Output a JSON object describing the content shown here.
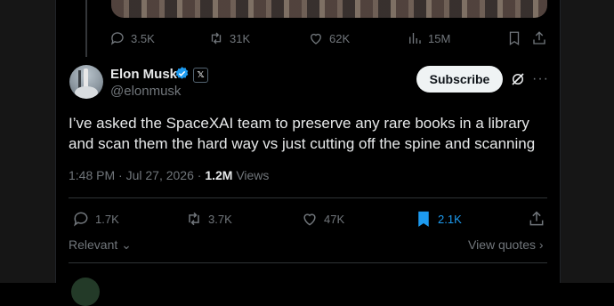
{
  "prev_tweet": {
    "actions": {
      "replies": "3.5K",
      "reposts": "31K",
      "likes": "62K",
      "views": "15M"
    }
  },
  "tweet": {
    "author_name": "Elon Musk",
    "handle": "@elonmusk",
    "x_badge": "𝕏",
    "subscribe_label": "Subscribe",
    "more_label": "···",
    "text": "I’ve asked the SpaceXAI team to preserve any rare books in a library and scan them the hard way vs just cutting off the spine and scanning",
    "timestamp": "1:48 PM · Jul 27, 2026 · ",
    "views_count": "1.2M",
    "views_label": " Views",
    "actions": {
      "replies": "1.7K",
      "reposts": "3.7K",
      "likes": "47K",
      "bookmarks": "2.1K"
    }
  },
  "replies_section": {
    "sort_label": "Relevant",
    "view_quotes_label": "View quotes"
  },
  "colors": {
    "accent": "#1d9bf0",
    "muted": "#71767b",
    "text": "#e7e9ea"
  }
}
